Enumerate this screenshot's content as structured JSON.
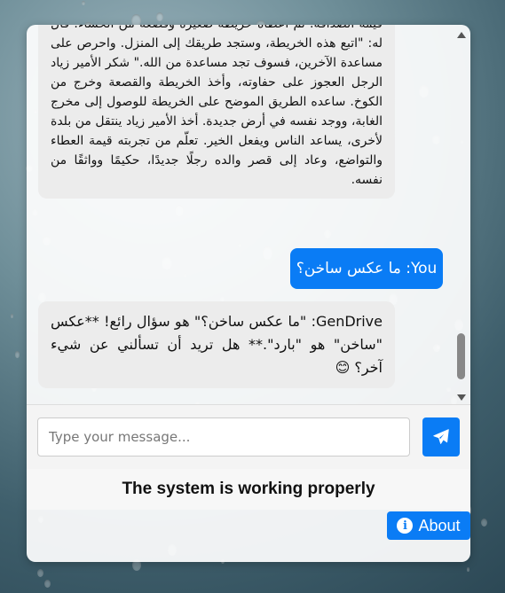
{
  "messages": [
    {
      "sender": "bot",
      "text": "قيمة الصداقة. ثم أعطاه خريطة صغيرة وقصعة من الحساء. قال له: \"اتبع هذه الخريطة، وستجد طريقك إلى المنزل. واحرص على مساعدة الآخرين، فسوف تجد مساعدة من الله.\" شكر الأمير زياد الرجل العجوز على حفاوته، وأخذ الخريطة والقصعة وخرج من الكوخ. ساعده الطريق الموضح على الخريطة للوصول إلى مخرج الغابة، ووجد نفسه في أرض جديدة. أخذ الأمير زياد ينتقل من بلدة لأخرى، يساعد الناس ويفعل الخير. تعلّم من تجربته قيمة العطاء والتواضع، وعاد إلى قصر والده رجلًا جديدًا، حكيمًا وواثقًا من نفسه."
    },
    {
      "sender": "user",
      "text": "You: ما عكس ساخن؟"
    },
    {
      "sender": "bot",
      "text": "GenDrive: \"ما عكس ساخن؟\" هو سؤال رائع! **عكس \"ساخن\" هو \"بارد\".** هل تريد أن تسألني عن شيء آخر؟ 😊"
    }
  ],
  "input": {
    "placeholder": "Type your message...",
    "value": ""
  },
  "send_icon": "paper-plane-icon",
  "status_text": "The system is working properly",
  "about_label": "About",
  "about_icon": "info-icon",
  "colors": {
    "accent": "#0a7cf5",
    "bot_bubble": "#ececec",
    "card": "#ffffff"
  }
}
